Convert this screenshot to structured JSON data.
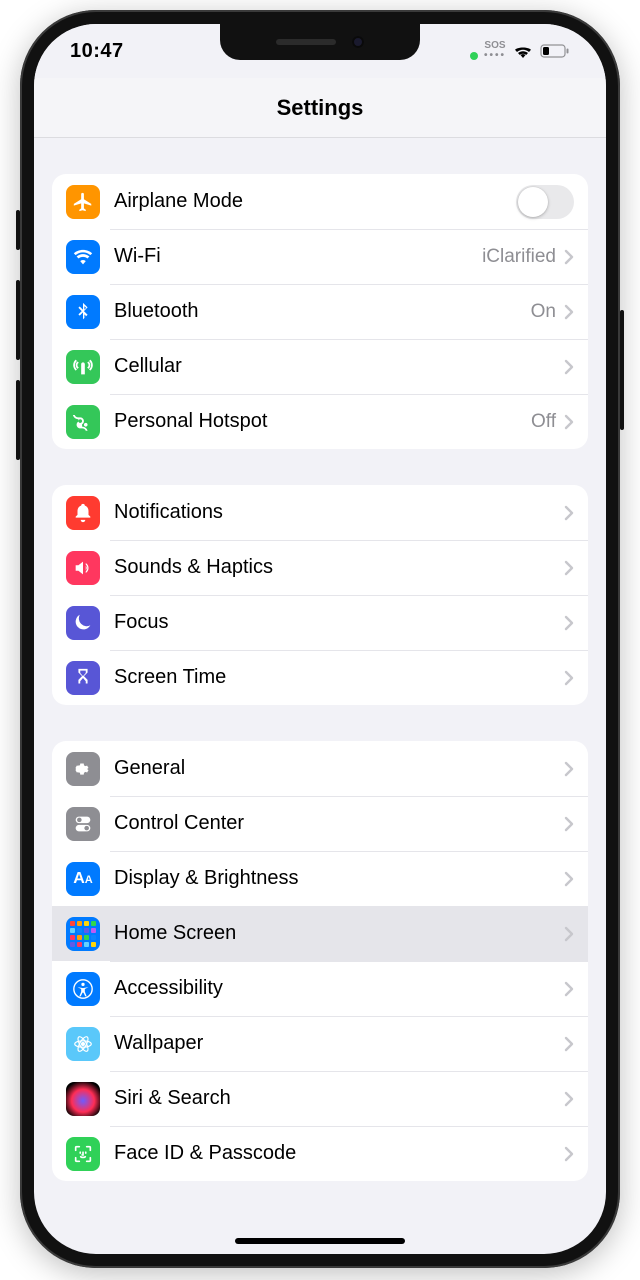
{
  "status": {
    "time": "10:47",
    "sos": "SOS"
  },
  "header": {
    "title": "Settings"
  },
  "groups": [
    {
      "rows": [
        {
          "id": "airplane",
          "icon": "airplane-icon",
          "color": "bg-orange",
          "label": "Airplane Mode",
          "type": "switch",
          "switch_on": false
        },
        {
          "id": "wifi",
          "icon": "wifi-icon",
          "color": "bg-blue",
          "label": "Wi-Fi",
          "type": "nav",
          "detail": "iClarified"
        },
        {
          "id": "bluetooth",
          "icon": "bluetooth-icon",
          "color": "bg-blue",
          "label": "Bluetooth",
          "type": "nav",
          "detail": "On"
        },
        {
          "id": "cellular",
          "icon": "cellular-icon",
          "color": "bg-green",
          "label": "Cellular",
          "type": "nav"
        },
        {
          "id": "hotspot",
          "icon": "hotspot-icon",
          "color": "bg-green",
          "label": "Personal Hotspot",
          "type": "nav",
          "detail": "Off"
        }
      ]
    },
    {
      "rows": [
        {
          "id": "notifications",
          "icon": "bell-icon",
          "color": "bg-red",
          "label": "Notifications",
          "type": "nav"
        },
        {
          "id": "sounds",
          "icon": "speaker-icon",
          "color": "bg-red2",
          "label": "Sounds & Haptics",
          "type": "nav"
        },
        {
          "id": "focus",
          "icon": "moon-icon",
          "color": "bg-indigo",
          "label": "Focus",
          "type": "nav"
        },
        {
          "id": "screentime",
          "icon": "hourglass-icon",
          "color": "bg-indigo",
          "label": "Screen Time",
          "type": "nav"
        }
      ]
    },
    {
      "rows": [
        {
          "id": "general",
          "icon": "gear-icon",
          "color": "bg-gray",
          "label": "General",
          "type": "nav"
        },
        {
          "id": "controlcenter",
          "icon": "toggles-icon",
          "color": "bg-gray",
          "label": "Control Center",
          "type": "nav"
        },
        {
          "id": "display",
          "icon": "aa-icon",
          "color": "bg-blue",
          "label": "Display & Brightness",
          "type": "nav"
        },
        {
          "id": "homescreen",
          "icon": "grid-icon",
          "color": "bg-blue",
          "label": "Home Screen",
          "type": "nav",
          "highlighted": true
        },
        {
          "id": "accessibility",
          "icon": "accessibility-icon",
          "color": "bg-blue",
          "label": "Accessibility",
          "type": "nav"
        },
        {
          "id": "wallpaper",
          "icon": "flower-icon",
          "color": "bg-teal",
          "label": "Wallpaper",
          "type": "nav"
        },
        {
          "id": "siri",
          "icon": "siri-icon",
          "color": "bg-siri",
          "label": "Siri & Search",
          "type": "nav"
        },
        {
          "id": "faceid",
          "icon": "faceid-icon",
          "color": "bg-green2",
          "label": "Face ID & Passcode",
          "type": "nav"
        }
      ]
    }
  ]
}
